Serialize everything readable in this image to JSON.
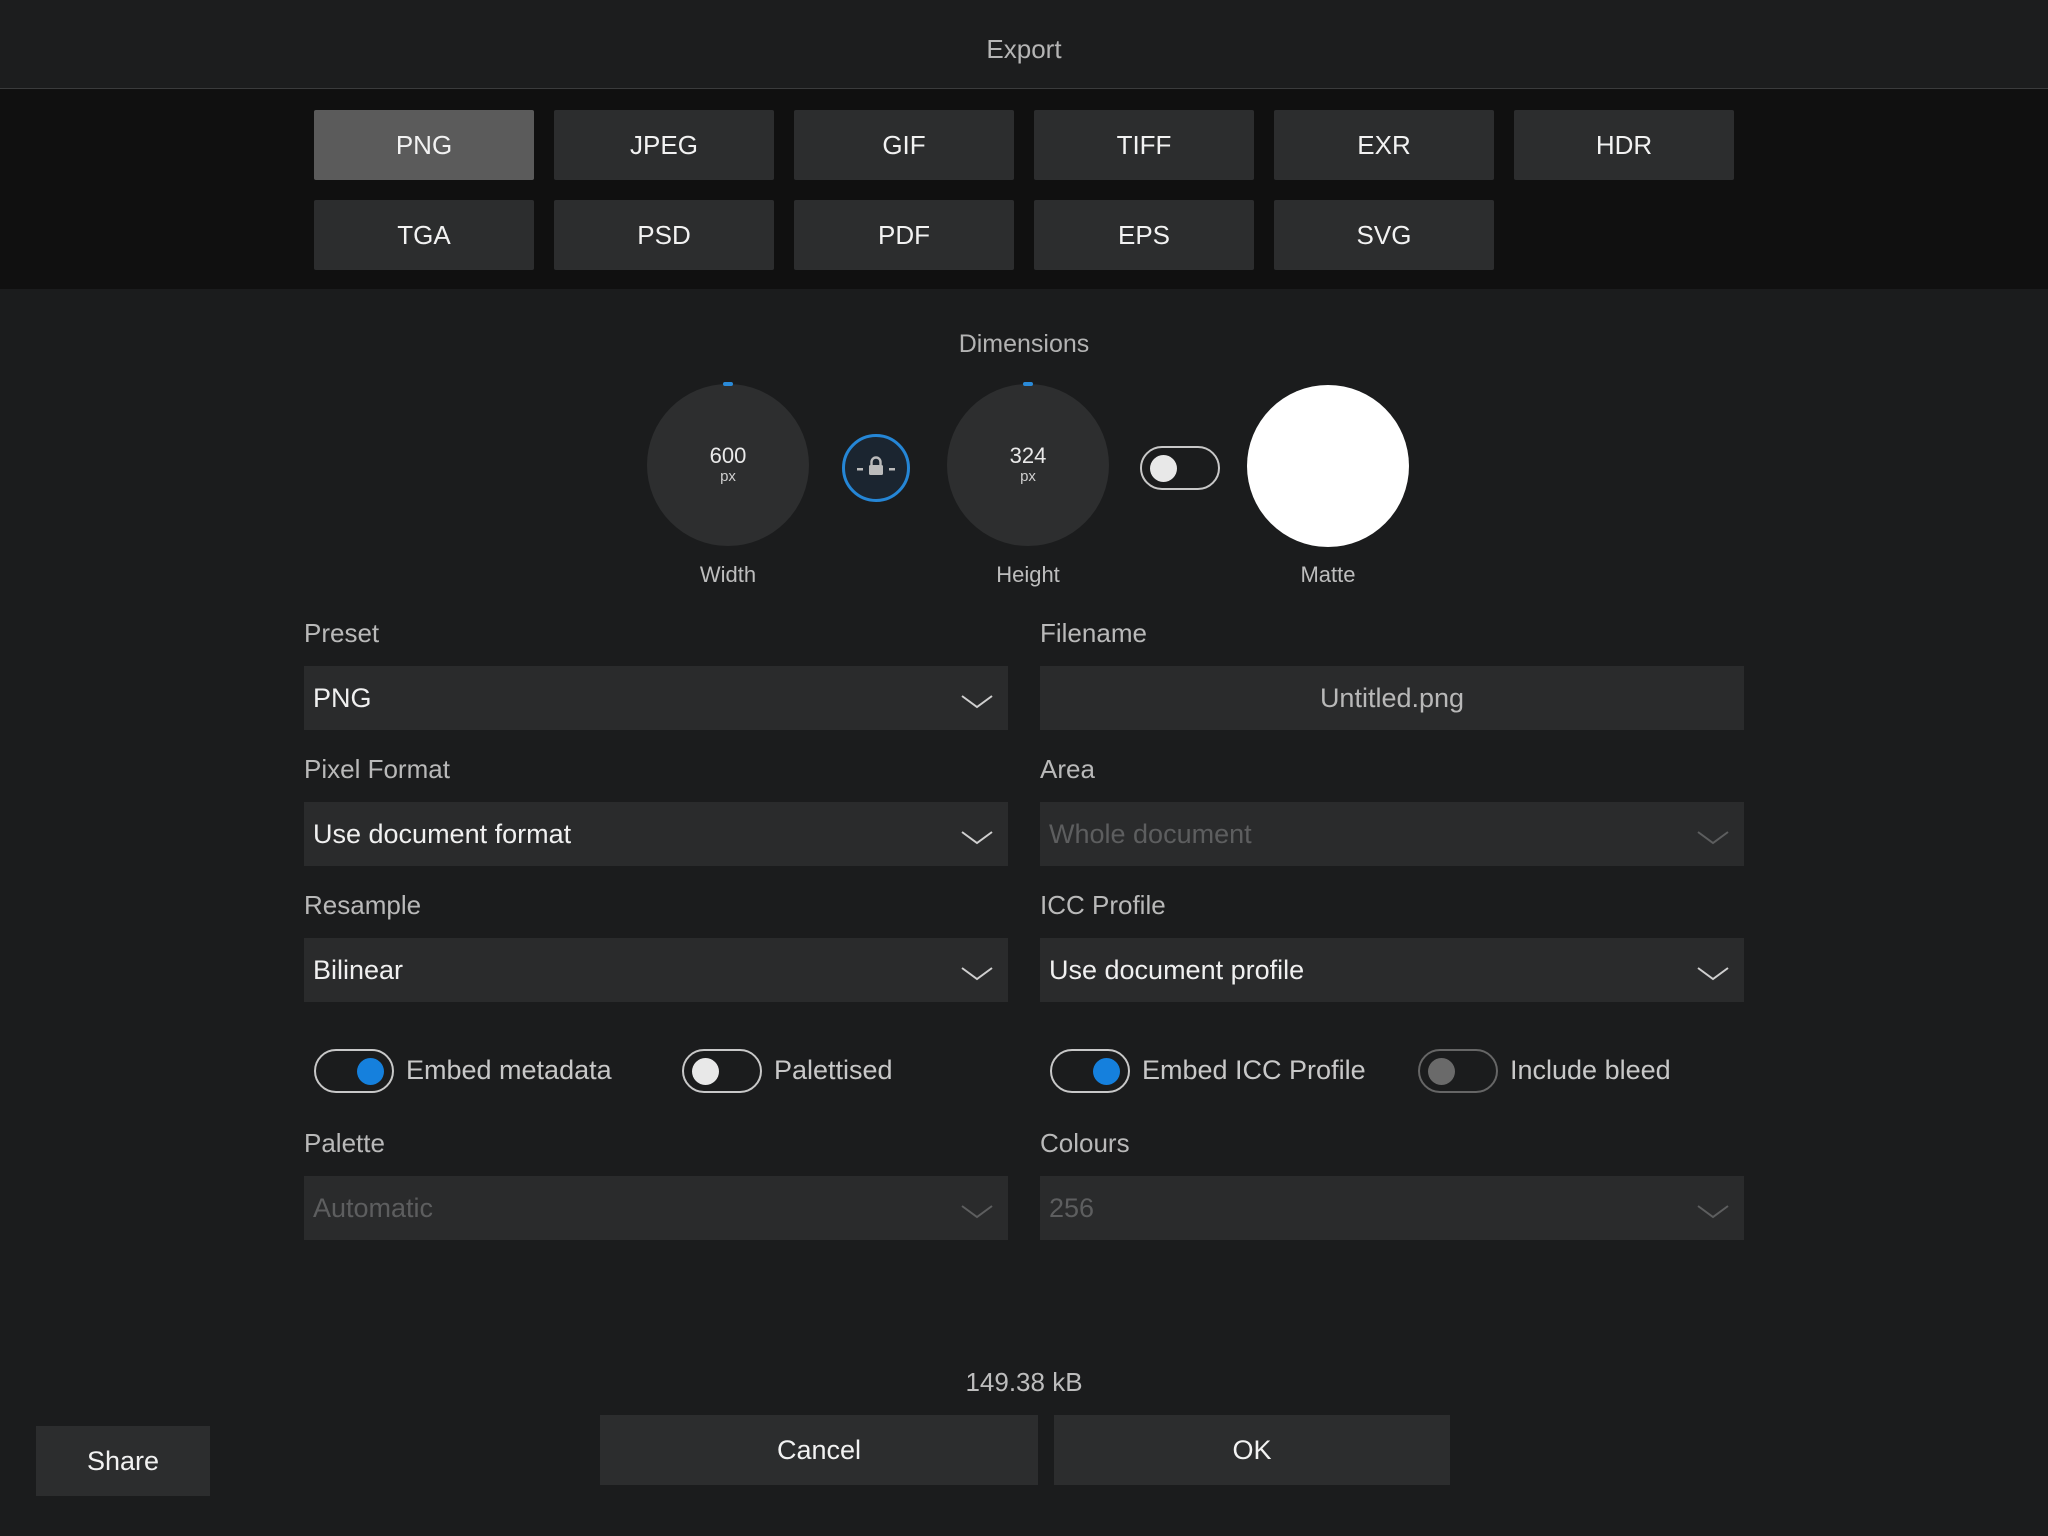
{
  "window": {
    "title": "Export"
  },
  "formats": [
    {
      "label": "PNG",
      "selected": true
    },
    {
      "label": "JPEG",
      "selected": false
    },
    {
      "label": "GIF",
      "selected": false
    },
    {
      "label": "TIFF",
      "selected": false
    },
    {
      "label": "EXR",
      "selected": false
    },
    {
      "label": "HDR",
      "selected": false
    },
    {
      "label": "TGA",
      "selected": false
    },
    {
      "label": "PSD",
      "selected": false
    },
    {
      "label": "PDF",
      "selected": false
    },
    {
      "label": "EPS",
      "selected": false
    },
    {
      "label": "SVG",
      "selected": false
    }
  ],
  "dimensions": {
    "title": "Dimensions",
    "width": {
      "value": "600",
      "unit": "px",
      "label": "Width"
    },
    "height": {
      "value": "324",
      "unit": "px",
      "label": "Height"
    },
    "lock_icon": "lock-icon",
    "matte": {
      "label": "Matte",
      "color": "#ffffff",
      "enabled": false
    }
  },
  "fields": {
    "preset": {
      "label": "Preset",
      "value": "PNG"
    },
    "filename": {
      "label": "Filename",
      "value": "Untitled.png"
    },
    "pixel_format": {
      "label": "Pixel Format",
      "value": "Use document format"
    },
    "area": {
      "label": "Area",
      "value": "Whole document"
    },
    "resample": {
      "label": "Resample",
      "value": "Bilinear"
    },
    "icc_profile": {
      "label": "ICC Profile",
      "value": "Use document profile"
    },
    "palette": {
      "label": "Palette",
      "value": "Automatic"
    },
    "colours": {
      "label": "Colours",
      "value": "256"
    }
  },
  "toggles": {
    "embed_metadata": {
      "label": "Embed metadata",
      "on": true
    },
    "palettised": {
      "label": "Palettised",
      "on": false
    },
    "embed_icc": {
      "label": "Embed ICC Profile",
      "on": true
    },
    "include_bleed": {
      "label": "Include bleed",
      "on": false
    }
  },
  "footer": {
    "file_size": "149.38 kB",
    "share_label": "Share",
    "cancel_label": "Cancel",
    "ok_label": "OK"
  },
  "colors": {
    "accent": "#1580dd",
    "selected_format": "#5b5b5b"
  }
}
